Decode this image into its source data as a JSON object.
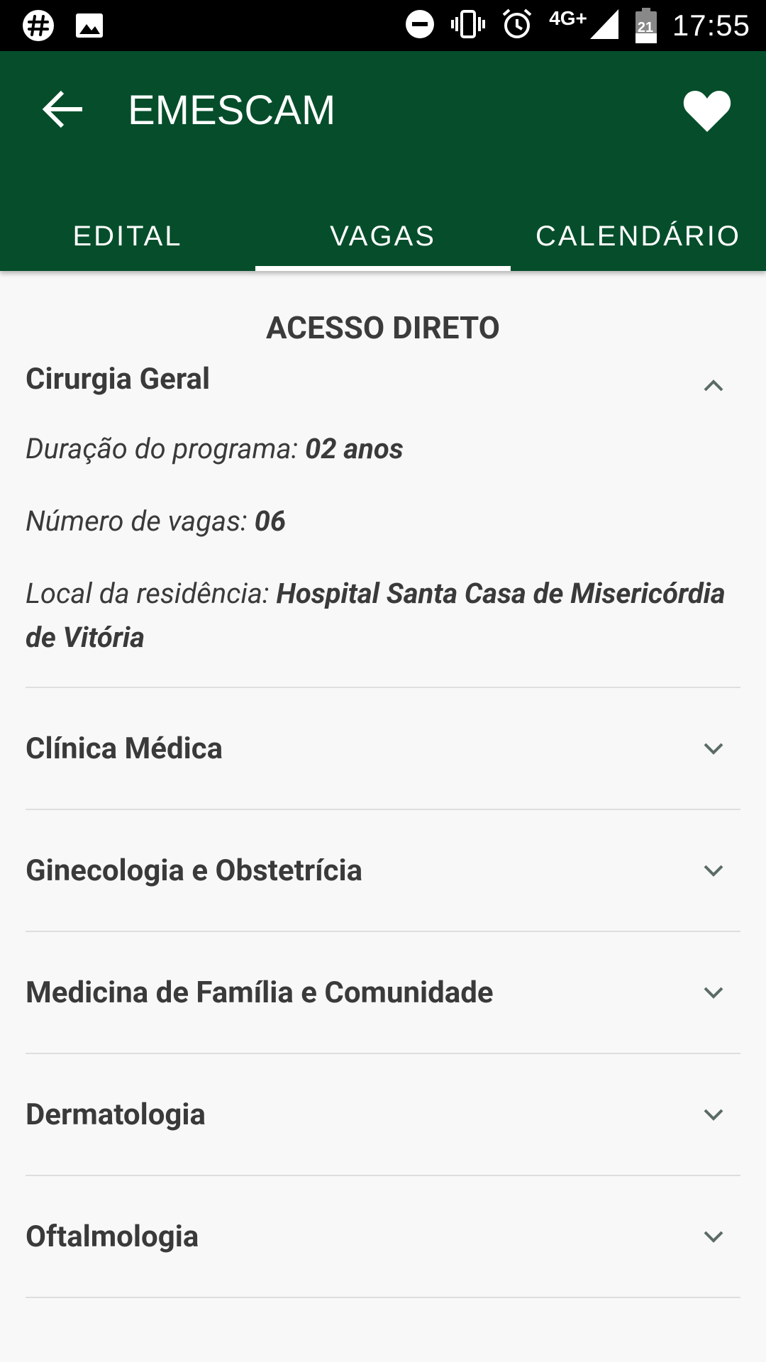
{
  "statusbar": {
    "network": "4G+",
    "battery_level": "21",
    "time": "17:55"
  },
  "appbar": {
    "title": "EMESCAM"
  },
  "tabs": [
    {
      "label": "EDITAL"
    },
    {
      "label": "VAGAS"
    },
    {
      "label": "CALENDÁRIO"
    }
  ],
  "content": {
    "section_title": "ACESSO DIRETO",
    "items": [
      {
        "title": "Cirurgia Geral",
        "duration_label": "Duração do programa: ",
        "duration_value": "02 anos",
        "vacancies_label": "Número de vagas: ",
        "vacancies_value": "06",
        "location_label": "Local da residência: ",
        "location_value": "Hospital Santa Casa de Misericórdia de Vitória"
      },
      {
        "title": "Clínica Médica"
      },
      {
        "title": "Ginecologia e Obstetrícia"
      },
      {
        "title": "Medicina de Família e Comunidade"
      },
      {
        "title": "Dermatologia"
      },
      {
        "title": "Oftalmologia"
      }
    ]
  },
  "colors": {
    "primary": "#064e2b",
    "background": "#f8f8f8",
    "text": "#3a3a3a",
    "chevron": "#5b6b66",
    "divider": "#dedede"
  }
}
